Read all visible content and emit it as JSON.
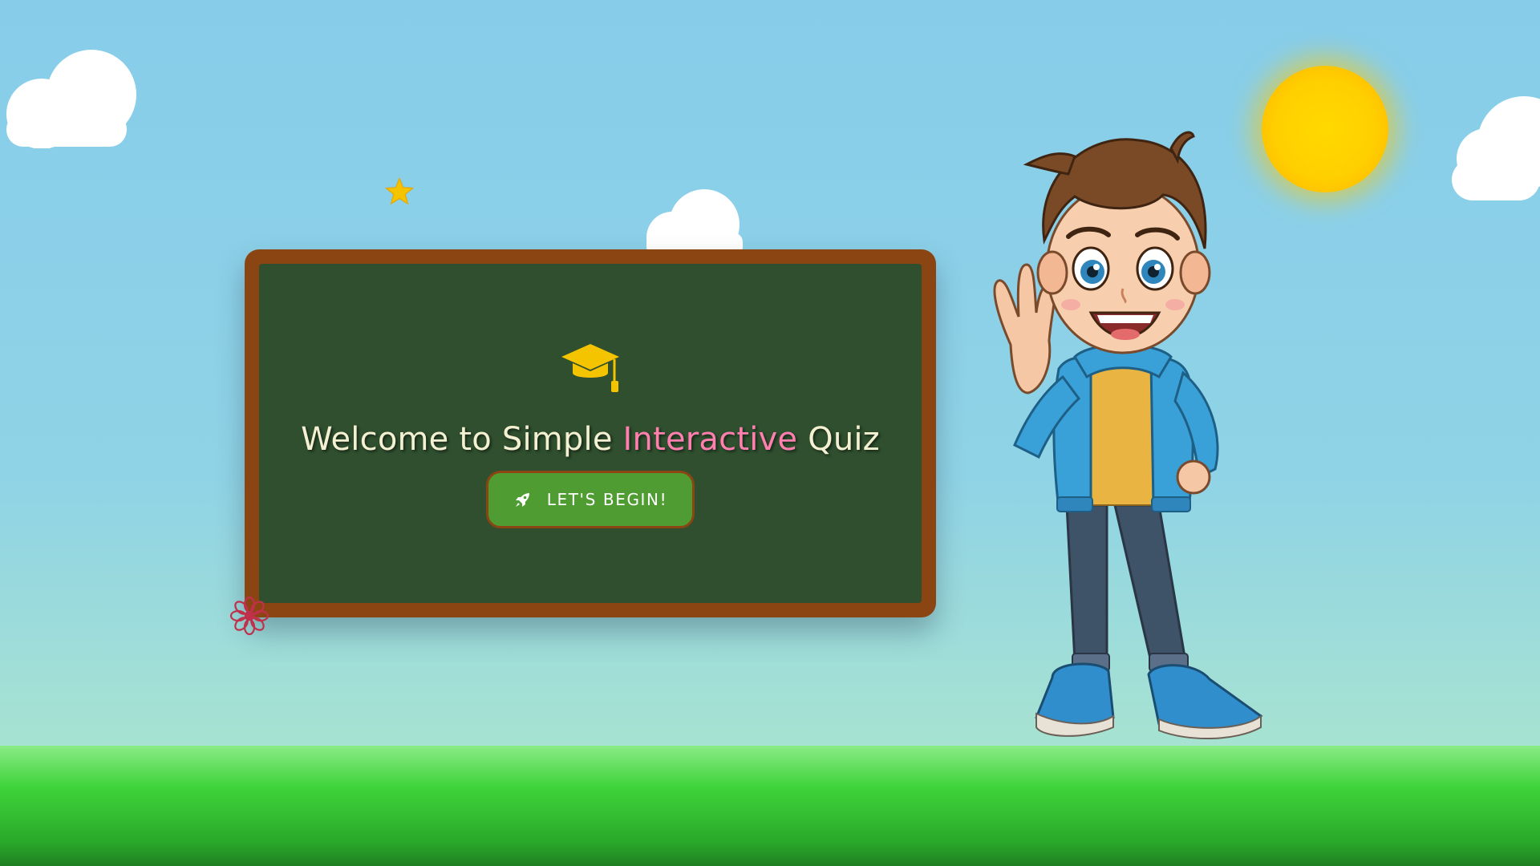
{
  "colors": {
    "sky_top": "#87cdea",
    "ground": "#3ed33a",
    "board_frame": "#8b4513",
    "board_surface": "#2f4f2f",
    "title_text": "#f4f0d2",
    "title_accent": "#ff7fae",
    "button": "#4e9c32",
    "icon_gold": "#f5c400"
  },
  "board": {
    "icon": "graduation-cap-icon",
    "title_part1": "Welcome to Simple ",
    "title_accent": "Interactive",
    "title_part2": " Quiz",
    "button": {
      "icon": "rocket-icon",
      "label": "LET'S BEGIN!"
    }
  },
  "scene": {
    "character": "waving-boy-illustration",
    "decorations": [
      "cloud",
      "cloud",
      "cloud",
      "sun",
      "star",
      "flower"
    ]
  }
}
